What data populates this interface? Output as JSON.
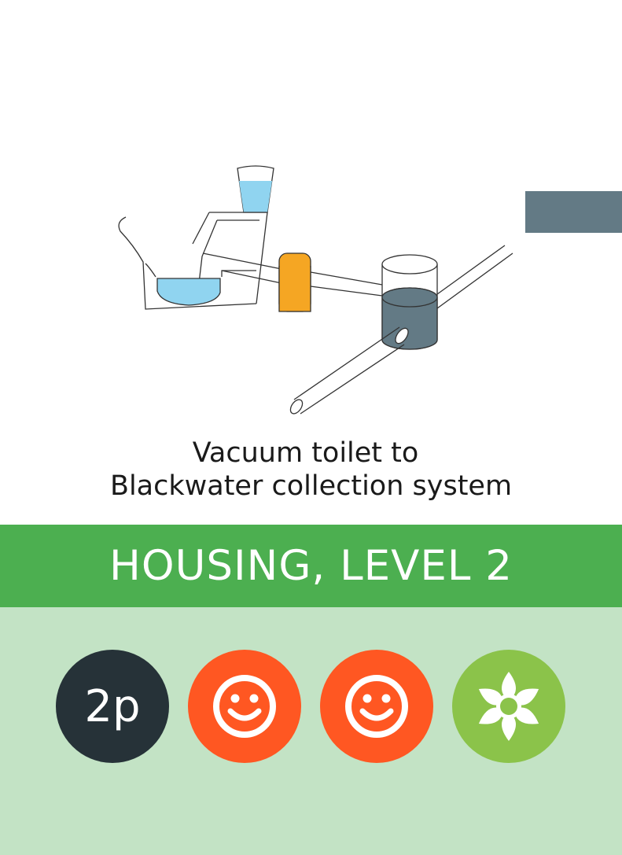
{
  "card": {
    "caption_line1": "Vacuum toilet to",
    "caption_line2": "Blackwater collection system",
    "category": "HOUSING, LEVEL 2",
    "points": "2p"
  },
  "icons": [
    "toilet-illustration",
    "smiley-icon",
    "smiley-icon",
    "flower-icon"
  ],
  "colors": {
    "banner": "#4caf50",
    "bottom_panel": "#c3e3c5",
    "points_token": "#263238",
    "smiley_token": "#ff5722",
    "flower_token": "#8bc34a",
    "corner_tab": "#637a85",
    "water": "#90d4f0",
    "valve": "#f5a623",
    "tank_fill": "#637a85"
  }
}
